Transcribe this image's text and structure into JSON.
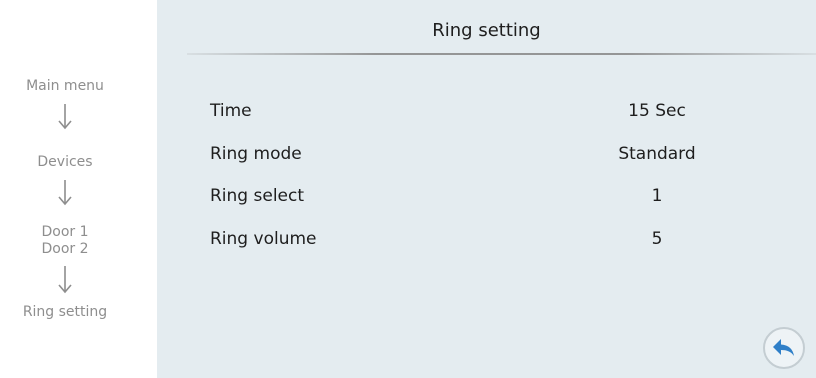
{
  "flow": {
    "steps": [
      "Main menu",
      "Devices",
      "Door 1",
      "Door 2",
      "Ring setting"
    ],
    "arrow_icon": "arrow-down-icon"
  },
  "panel": {
    "title": "Ring setting",
    "rows": [
      {
        "label": "Time",
        "value": "15 Sec"
      },
      {
        "label": "Ring mode",
        "value": "Standard"
      },
      {
        "label": "Ring select",
        "value": "1"
      },
      {
        "label": "Ring volume",
        "value": "5"
      }
    ],
    "back_icon": "back-arrow-icon"
  },
  "colors": {
    "panel_bg": "#e4ecf0",
    "flow_text": "#8e8e8e",
    "back_arrow": "#2f7fc8"
  }
}
